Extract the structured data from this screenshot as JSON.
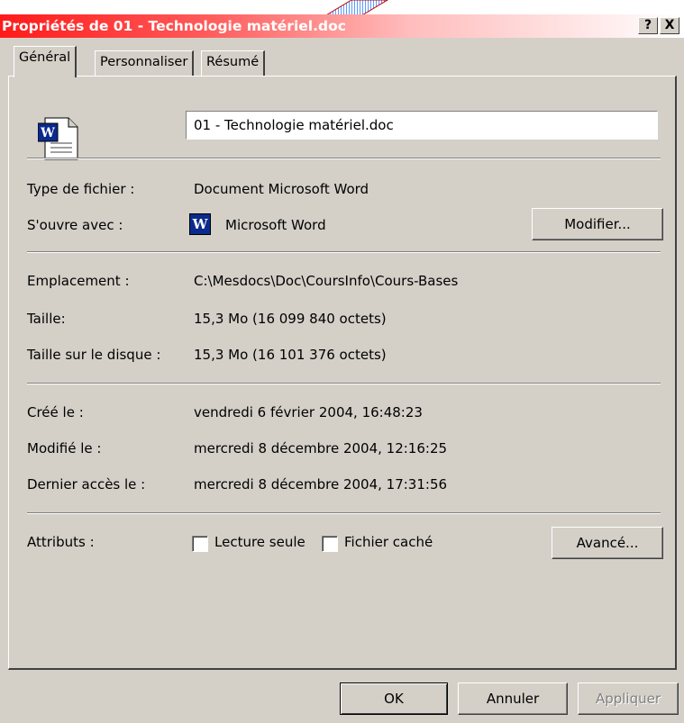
{
  "window": {
    "title": "Propriétés de 01 - Technologie matériel.doc",
    "help_label": "?",
    "close_label": "X"
  },
  "tabs": [
    {
      "label": "Général",
      "active": true
    },
    {
      "label": "Personnaliser",
      "active": false
    },
    {
      "label": "Résumé",
      "active": false
    }
  ],
  "file": {
    "name": "01 - Technologie matériel.doc",
    "icon": "word-document-icon"
  },
  "props": {
    "type_label": "Type de fichier :",
    "type_value": "Document Microsoft Word",
    "opens_label": "S'ouvre avec :",
    "opens_value": "Microsoft Word",
    "modify_button": "Modifier...",
    "location_label": "Emplacement :",
    "location_value": "C:\\Mesdocs\\Doc\\CoursInfo\\Cours-Bases",
    "size_label": "Taille:",
    "size_value": "15,3 Mo (16 099 840 octets)",
    "disk_label": "Taille sur le disque :",
    "disk_value": "15,3 Mo (16 101 376 octets)",
    "created_label": "Créé le :",
    "created_value": "vendredi 6 février 2004, 16:48:23",
    "modified_label": "Modifié le :",
    "modified_value": "mercredi 8 décembre 2004, 12:16:25",
    "accessed_label": "Dernier accès le :",
    "accessed_value": "mercredi 8 décembre 2004, 17:31:56",
    "attributes_label": "Attributs :",
    "readonly_label": "Lecture seule",
    "readonly_checked": false,
    "hidden_label": "Fichier caché",
    "hidden_checked": false,
    "advanced_button": "Avancé..."
  },
  "footer": {
    "ok": "OK",
    "cancel": "Annuler",
    "apply": "Appliquer"
  },
  "colors": {
    "titlebar_start": "#ff1a1a",
    "face": "#d4d0c8",
    "word_blue": "#0b2a8c"
  }
}
